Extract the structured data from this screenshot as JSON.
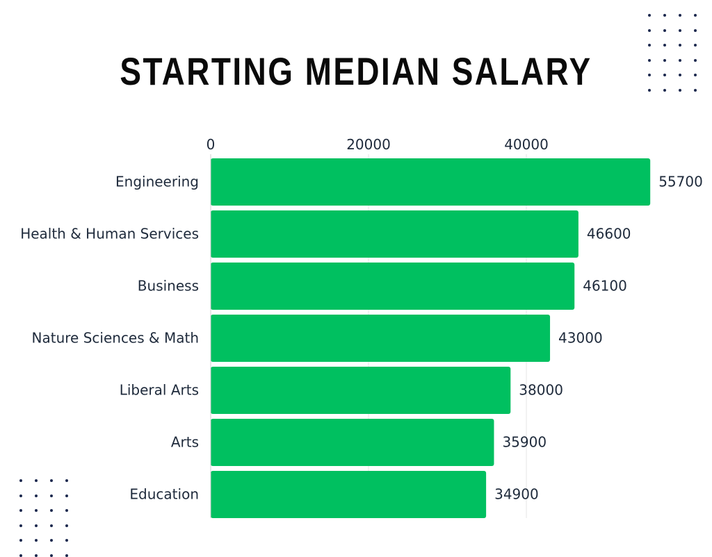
{
  "title": "STARTING MEDIAN SALARY",
  "colors": {
    "bar": "#00c060",
    "grid": "#e4e4e4",
    "text": "#1e2a3b",
    "dot": "#1e2a4f"
  },
  "chart_data": {
    "type": "bar",
    "orientation": "horizontal",
    "title": "STARTING MEDIAN SALARY",
    "categories": [
      "Engineering",
      "Health & Human Services",
      "Business",
      "Nature Sciences & Math",
      "Liberal Arts",
      "Arts",
      "Education"
    ],
    "values": [
      55700,
      46600,
      46100,
      43000,
      38000,
      35900,
      34900
    ],
    "x_ticks": [
      0,
      20000,
      40000
    ],
    "xlim": [
      0,
      60000
    ],
    "x_axis_position": "top",
    "grid": true,
    "data_labels": true
  }
}
